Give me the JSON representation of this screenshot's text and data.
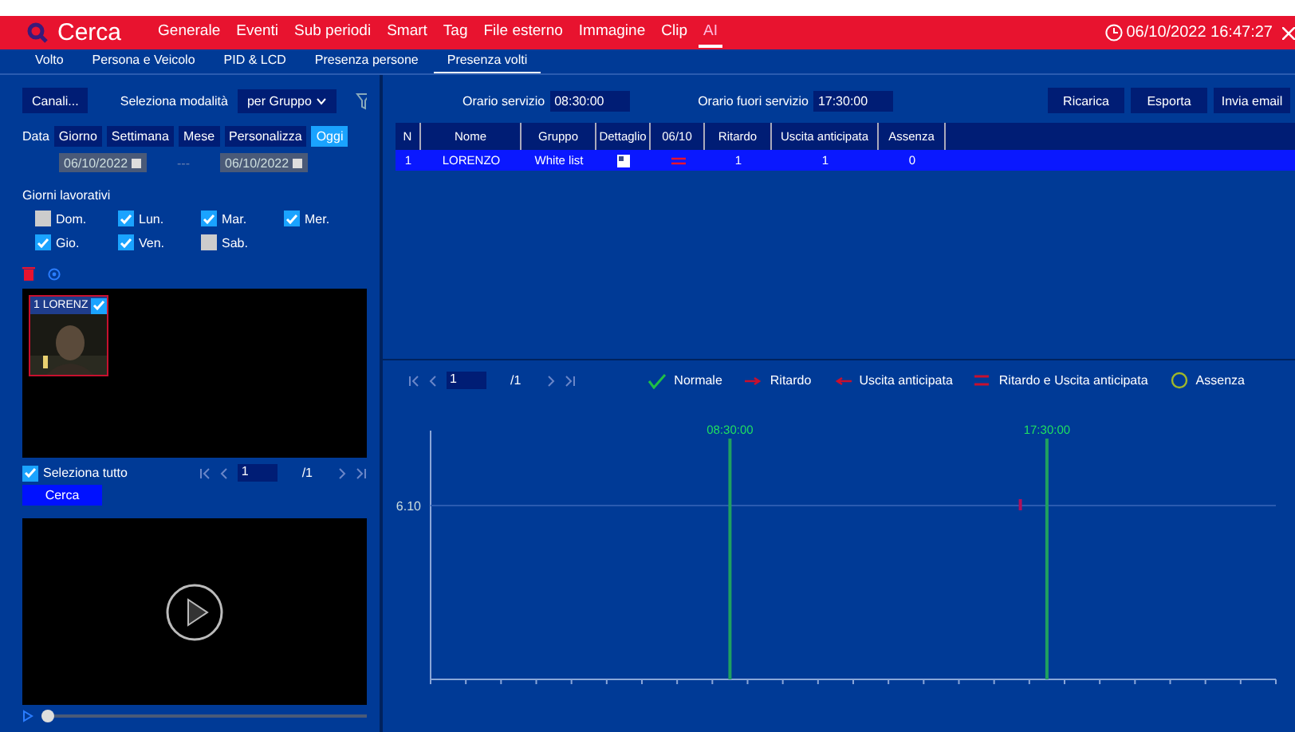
{
  "header": {
    "title": "Cerca",
    "menu": [
      {
        "label": "Generale",
        "selected": false
      },
      {
        "label": "Eventi",
        "selected": false
      },
      {
        "label": "Sub periodi",
        "selected": false
      },
      {
        "label": "Smart",
        "selected": false
      },
      {
        "label": "Tag",
        "selected": false
      },
      {
        "label": "File esterno",
        "selected": false
      },
      {
        "label": "Immagine",
        "selected": false
      },
      {
        "label": "Clip",
        "selected": false
      },
      {
        "label": "AI",
        "selected": true
      }
    ],
    "datetime": "06/10/2022 16:47:27"
  },
  "subtabs": [
    {
      "label": "Volto",
      "selected": false
    },
    {
      "label": "Persona e Veicolo",
      "selected": false
    },
    {
      "label": "PID & LCD",
      "selected": false
    },
    {
      "label": "Presenza persone",
      "selected": false
    },
    {
      "label": "Presenza volti",
      "selected": true
    }
  ],
  "left": {
    "channels_button": "Canali...",
    "mode_label": "Seleziona modalità",
    "mode_value": "per Gruppo",
    "date_label": "Data",
    "date_ranges": [
      {
        "label": "Giorno",
        "selected": false
      },
      {
        "label": "Settimana",
        "selected": false
      },
      {
        "label": "Mese",
        "selected": false
      },
      {
        "label": "Personalizza",
        "selected": false
      },
      {
        "label": "Oggi",
        "selected": true
      }
    ],
    "date_from": "06/10/2022",
    "date_sep": "---",
    "date_to": "06/10/2022",
    "workdays_label": "Giorni lavorativi",
    "workdays": [
      {
        "label": "Dom.",
        "checked": false
      },
      {
        "label": "Lun.",
        "checked": true
      },
      {
        "label": "Mar.",
        "checked": true
      },
      {
        "label": "Mer.",
        "checked": true
      },
      {
        "label": "Gio.",
        "checked": true
      },
      {
        "label": "Ven.",
        "checked": true
      },
      {
        "label": "Sab.",
        "checked": false
      }
    ],
    "thumbnails": [
      {
        "caption": "1 LORENZ",
        "checked": true,
        "selected": true
      }
    ],
    "select_all": {
      "label": "Seleziona tutto",
      "checked": true
    },
    "pager": {
      "page": "1",
      "total": "/1"
    },
    "search_button": "Cerca",
    "video": {
      "level": 0
    }
  },
  "right": {
    "service_start": {
      "label": "Orario servizio",
      "value": "08:30:00"
    },
    "service_end": {
      "label": "Orario fuori servizio",
      "value": "17:30:00"
    },
    "buttons": [
      "Ricarica",
      "Esporta",
      "Invia email"
    ],
    "table": {
      "columns": [
        "N",
        "Nome",
        "Gruppo",
        "Dettaglio",
        "06/10",
        "Ritardo",
        "Uscita anticipata",
        "Assenza"
      ],
      "rows": [
        {
          "selected": true,
          "n": "1",
          "name": "LORENZO",
          "group": "White list",
          "late": "1",
          "early": "1",
          "absent": "0"
        }
      ]
    },
    "pager": {
      "page": "1",
      "total": "/1"
    },
    "legend": [
      {
        "kind": "normal",
        "label": "Normale"
      },
      {
        "kind": "late",
        "label": "Ritardo"
      },
      {
        "kind": "early",
        "label": "Uscita anticipata"
      },
      {
        "kind": "both",
        "label": "Ritardo e Uscita anticipata"
      },
      {
        "kind": "absent",
        "label": "Assenza"
      }
    ],
    "timeline": {
      "row_label": "6.10",
      "markers": [
        "08:30:00",
        "17:30:00"
      ]
    }
  }
}
